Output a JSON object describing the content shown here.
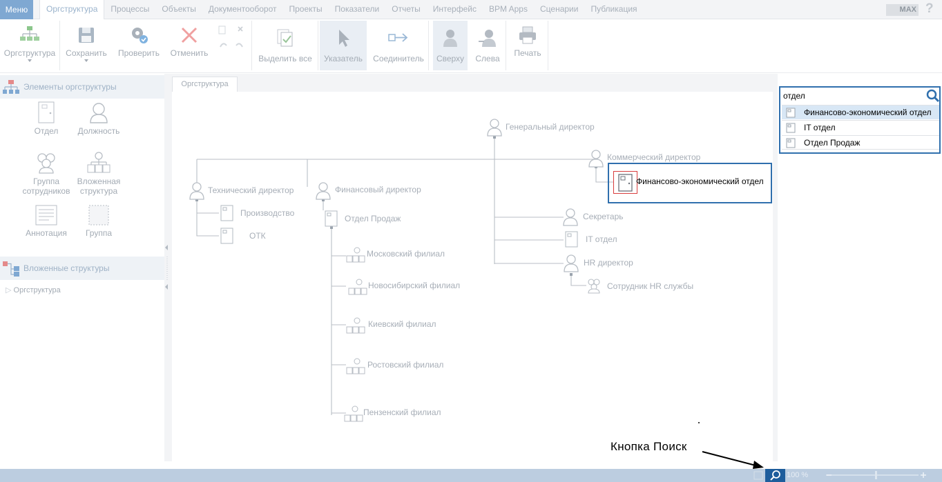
{
  "menu": {
    "menu_label": "Меню",
    "tabs": [
      "Оргструктура",
      "Процессы",
      "Объекты",
      "Документооборот",
      "Проекты",
      "Показатели",
      "Отчеты",
      "Интерфейс",
      "BPM Apps",
      "Сценарии",
      "Публикация"
    ],
    "active_tab": "Оргструктура",
    "max_label": "MAX",
    "help_label": "?"
  },
  "ribbon": {
    "orgstructure": "Оргструктура",
    "save": "Сохранить",
    "check": "Проверить",
    "cancel": "Отменить",
    "select_all": "Выделить все",
    "pointer": "Указатель",
    "connector": "Соединитель",
    "top": "Сверху",
    "left": "Слева",
    "print": "Печать"
  },
  "left_panel": {
    "elements_title": "Элементы оргструктуры",
    "elements": {
      "department": "Отдел",
      "position": "Должность",
      "group_line1": "Группа",
      "group_line2": "сотрудников",
      "nested_line1": "Вложенная",
      "nested_line2": "структура",
      "annotation": "Аннотация",
      "group": "Группа"
    },
    "nested_title": "Вложенные структуры",
    "tree_item": "Оргструктура"
  },
  "canvas": {
    "tab_label": "Оргструктура",
    "nodes": {
      "general_director": "Генеральный директор",
      "commercial_director": "Коммерческий директор",
      "fin_econ_department": "Финансово-экономический отдел",
      "technical_director": "Технический директор",
      "financial_director": "Финансовый директор",
      "production": "Производство",
      "otk": "ОТК",
      "sales_department": "Отдел Продаж",
      "secretary": "Секретарь",
      "it_department": "IT отдел",
      "hr_director": "HR директор",
      "hr_staff": "Сотрудник HR службы",
      "moscow_branch": "Московский филиал",
      "novosibirsk_branch": "Новосибирский филиал",
      "kyiv_branch": "Киевский филиал",
      "rostov_branch": "Ростовский филиал",
      "penza_branch": "Пензенский филиал"
    },
    "annotation": "Кнопка Поиск"
  },
  "search": {
    "query": "отдел",
    "results": [
      "Финансово-экономический отдел",
      "IT отдел",
      "Отдел Продаж"
    ],
    "highlighted_index": 0
  },
  "status": {
    "zoom": "100 %"
  },
  "colors": {
    "menu_accent": "#7fa8d2",
    "highlight_border": "#2f6fad",
    "selection_red": "#d83b3b",
    "status_bar": "#bccde0",
    "search_toggle": "#1e5d9c"
  }
}
